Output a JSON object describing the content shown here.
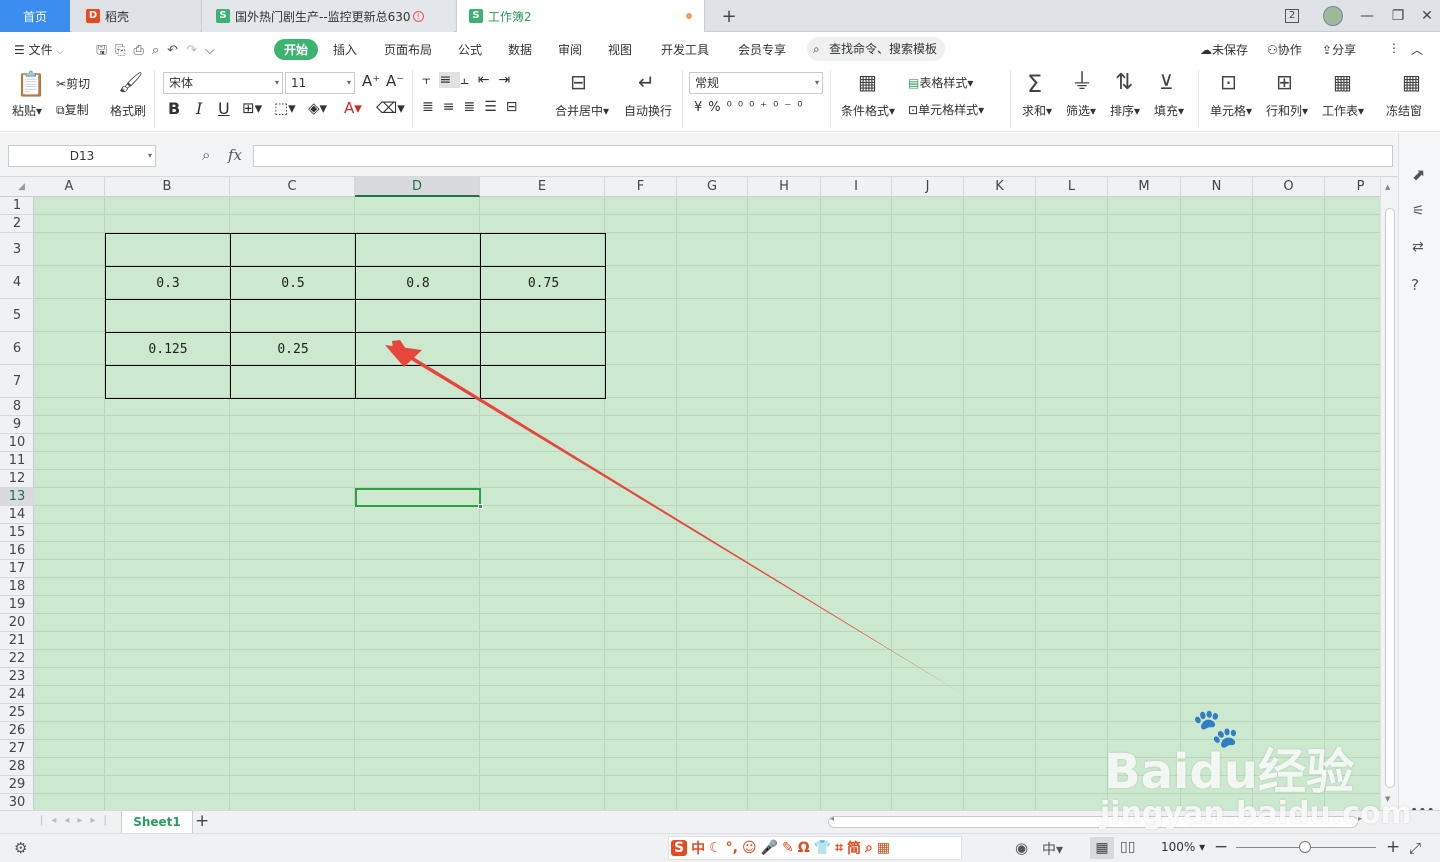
{
  "tabs": {
    "home": "首页",
    "tab1": "稻壳",
    "tab2": "国外热门剧生产--监控更新总630",
    "tab3": "工作簿2",
    "add": "+",
    "window_count": "2"
  },
  "menu": {
    "file": "文件",
    "items": [
      "开始",
      "插入",
      "页面布局",
      "公式",
      "数据",
      "审阅",
      "视图",
      "开发工具",
      "会员专享"
    ],
    "search": "查找命令、搜索模板",
    "unsaved": "未保存",
    "collab": "协作",
    "share": "分享"
  },
  "ribbon": {
    "paste": "粘贴",
    "cut": "剪切",
    "copy": "复制",
    "format_painter": "格式刷",
    "font_name": "宋体",
    "font_size": "11",
    "merge_center": "合并居中",
    "wrap_text": "自动换行",
    "number_format": "常规",
    "conditional_format": "条件格式",
    "table_style": "表格样式",
    "cell_style": "单元格样式",
    "sum": "求和",
    "filter": "筛选",
    "sort": "排序",
    "fill": "填充",
    "cell": "单元格",
    "row_col": "行和列",
    "worksheet": "工作表",
    "freeze": "冻结窗"
  },
  "formula_bar": {
    "name_box": "D13",
    "fx": "fx",
    "formula": ""
  },
  "grid": {
    "columns": [
      "A",
      "B",
      "C",
      "D",
      "E",
      "F",
      "G",
      "H",
      "I",
      "J",
      "K",
      "L",
      "M",
      "N",
      "O",
      "P"
    ],
    "rows": [
      "1",
      "2",
      "3",
      "4",
      "5",
      "6",
      "7",
      "8",
      "9",
      "10",
      "11",
      "12",
      "13",
      "14",
      "15",
      "16",
      "17",
      "18",
      "19",
      "20",
      "21",
      "22",
      "23",
      "24",
      "25",
      "26",
      "27",
      "28",
      "29",
      "30"
    ],
    "selected_cell": "D13",
    "table": [
      [
        "",
        "",
        "",
        ""
      ],
      [
        "0.3",
        "0.5",
        "0.8",
        "0.75"
      ],
      [
        "",
        "",
        "",
        ""
      ],
      [
        "0.125",
        "0.25",
        "",
        ""
      ],
      [
        "",
        "",
        "",
        ""
      ]
    ]
  },
  "sheets": {
    "active": "Sheet1",
    "add": "+"
  },
  "status": {
    "zoom": "100%",
    "ime_label": "中"
  },
  "watermark": {
    "brand": "Baidu经验",
    "url": "jingyan.baidu.com"
  },
  "colors": {
    "accent_green": "#3cb371",
    "grid_bg": "#cce8cf",
    "arrow_red": "#e8453c",
    "home_tab_blue": "#3b8ef0"
  }
}
